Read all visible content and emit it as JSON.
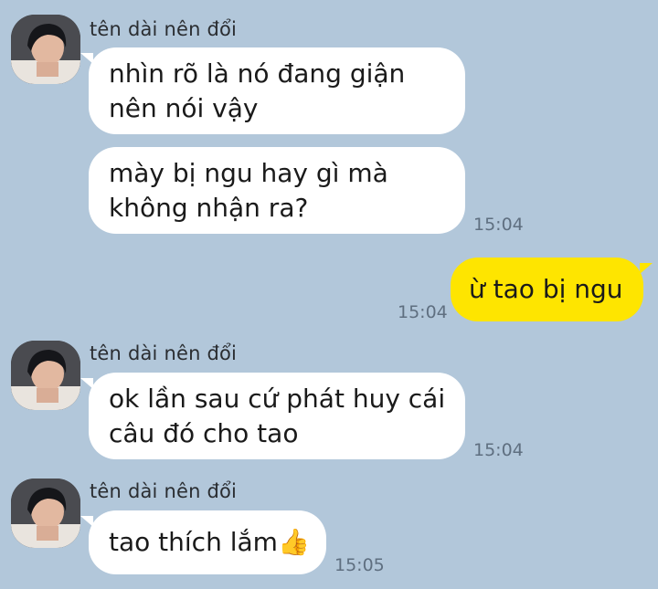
{
  "chat": {
    "groups": [
      {
        "sender": "tên dài nên đổi",
        "messages": [
          {
            "lines": [
              "nhìn rõ là nó đang giận",
              "nên nói vậy"
            ]
          },
          {
            "lines": [
              "mày bị ngu hay gì mà",
              "không nhận ra?"
            ],
            "time": "15:04"
          }
        ]
      },
      {
        "messages": [
          {
            "lines": [
              "ừ tao bị ngu"
            ],
            "time": "15:04",
            "mine": true
          }
        ]
      },
      {
        "sender": "tên dài nên đổi",
        "messages": [
          {
            "lines": [
              "ok lần sau cứ phát huy cái",
              "câu đó cho tao"
            ],
            "time": "15:04"
          }
        ]
      },
      {
        "sender": "tên dài nên đổi",
        "messages": [
          {
            "lines": [
              "tao thích lắm"
            ],
            "emoji": "👍",
            "time": "15:05"
          }
        ]
      }
    ]
  },
  "colors": {
    "background": "#b2c7da",
    "incoming_bubble": "#ffffff",
    "outgoing_bubble": "#fee500"
  },
  "icons": {
    "avatar": "profile-photo",
    "emoji": "thumbs-up-icon"
  }
}
